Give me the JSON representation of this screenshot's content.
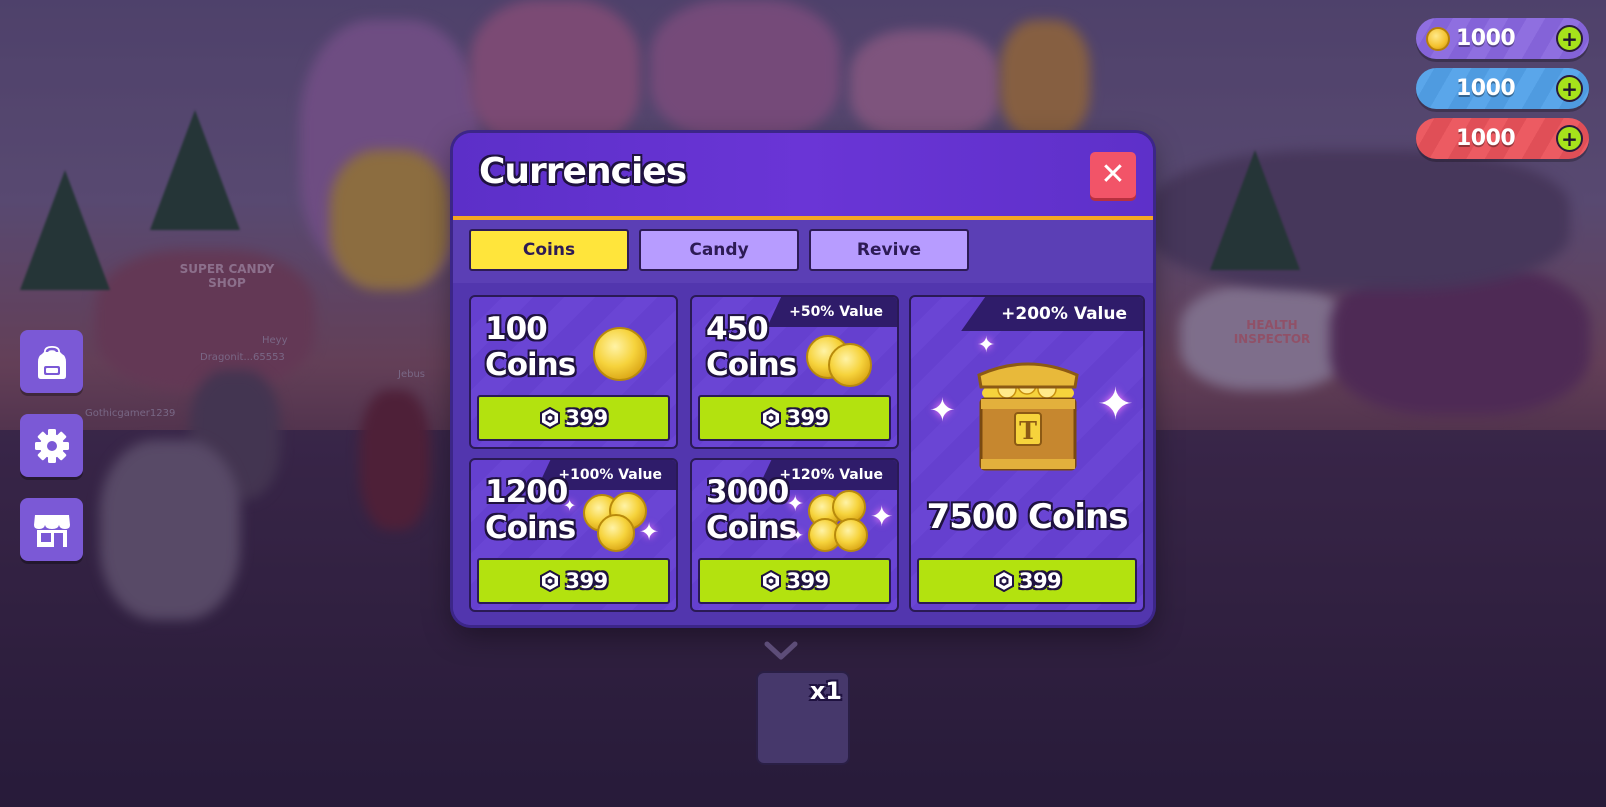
{
  "hud": {
    "coins": "1000",
    "candy": "1000",
    "revive": "1000",
    "coins_icon": "gold-coin-icon",
    "add_icon": "plus-icon"
  },
  "world": {
    "shop_sign": "SUPER CANDY SHOP",
    "truck_sign": "HEALTH INSPECTOR",
    "players": [
      "Dragonit...65553",
      "Gothicgamer1239",
      "Jebus",
      "Heyy"
    ]
  },
  "sidebar": {
    "items": [
      {
        "icon": "backpack-icon"
      },
      {
        "icon": "gear-icon"
      },
      {
        "icon": "shop-icon"
      }
    ]
  },
  "modal": {
    "title": "Currencies",
    "close_icon": "close-icon",
    "tabs": [
      {
        "label": "Coins",
        "active": true
      },
      {
        "label": "Candy",
        "active": false
      },
      {
        "label": "Revive",
        "active": false
      }
    ],
    "offers": [
      {
        "line1": "100",
        "line2": "Coins",
        "badge": "",
        "price": "399"
      },
      {
        "line1": "450",
        "line2": "Coins",
        "badge": "+50% Value",
        "price": "399"
      },
      {
        "line1": "1200",
        "line2": "Coins",
        "badge": "+100% Value",
        "price": "399"
      },
      {
        "line1": "3000",
        "line2": "Coins",
        "badge": "+120% Value",
        "price": "399"
      },
      {
        "line1": "7500 Coins",
        "line2": "",
        "badge": "+200% Value",
        "price": "399"
      }
    ],
    "price_icon": "robux-icon"
  },
  "hotbar": {
    "slot_count": "x1"
  },
  "colors": {
    "modal_bg": "#5b3fb5",
    "header_accent": "#f5a623",
    "active_tab": "#ffe53b",
    "inactive_tab": "#b79cff",
    "buy_button": "#b3e20f",
    "close_button": "#f25468"
  }
}
